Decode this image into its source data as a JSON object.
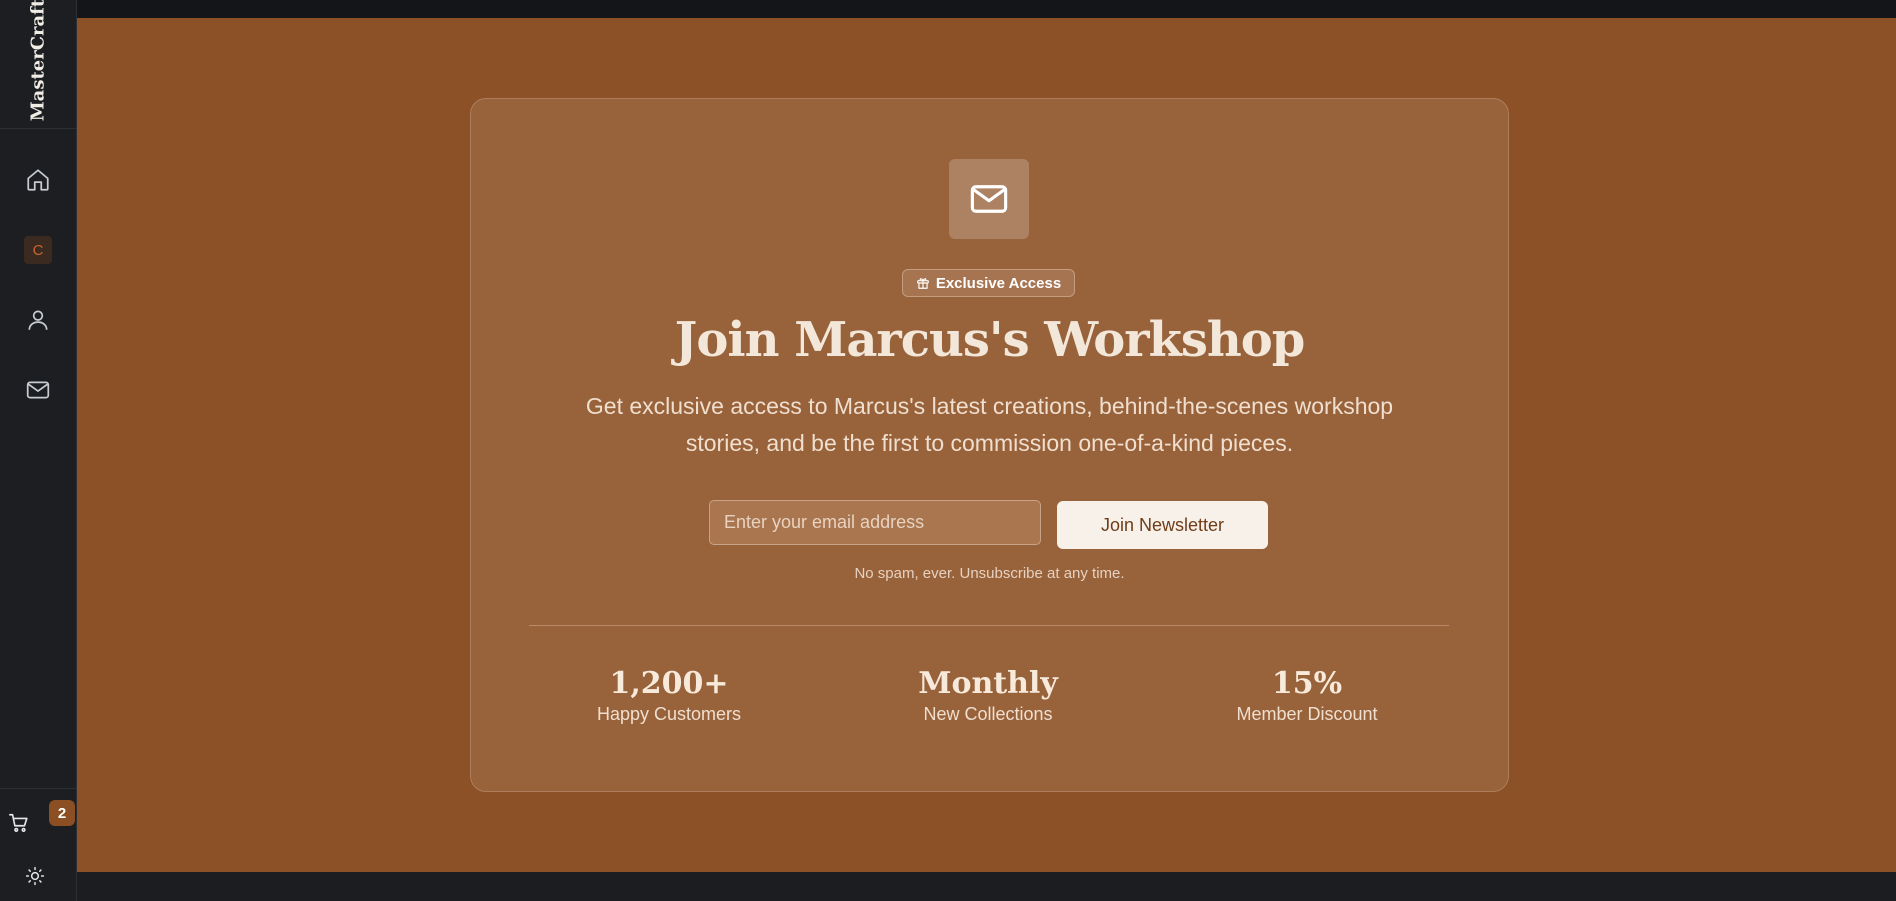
{
  "sidebar": {
    "brand": "MasterCraft",
    "nav": [
      {
        "name": "home",
        "icon": "home-icon"
      },
      {
        "name": "collection",
        "label": "C"
      },
      {
        "name": "profile",
        "icon": "user-icon"
      },
      {
        "name": "contact",
        "icon": "mail-icon"
      }
    ],
    "cart_count": "2"
  },
  "newsletter": {
    "badge": "Exclusive Access",
    "title": "Join Marcus's Workshop",
    "subtitle": "Get exclusive access to Marcus's latest creations, behind-the-scenes workshop stories, and be the first to commission one-of-a-kind pieces.",
    "email_placeholder": "Enter your email address",
    "button": "Join Newsletter",
    "note": "No spam, ever. Unsubscribe at any time."
  },
  "stats": [
    {
      "value": "1,200+",
      "label": "Happy Customers"
    },
    {
      "value": "Monthly",
      "label": "New Collections"
    },
    {
      "value": "15%",
      "label": "Member Discount"
    }
  ],
  "colors": {
    "page_accent": "#8c5126",
    "card": "#98623b",
    "sidebar": "#1c1e21"
  }
}
